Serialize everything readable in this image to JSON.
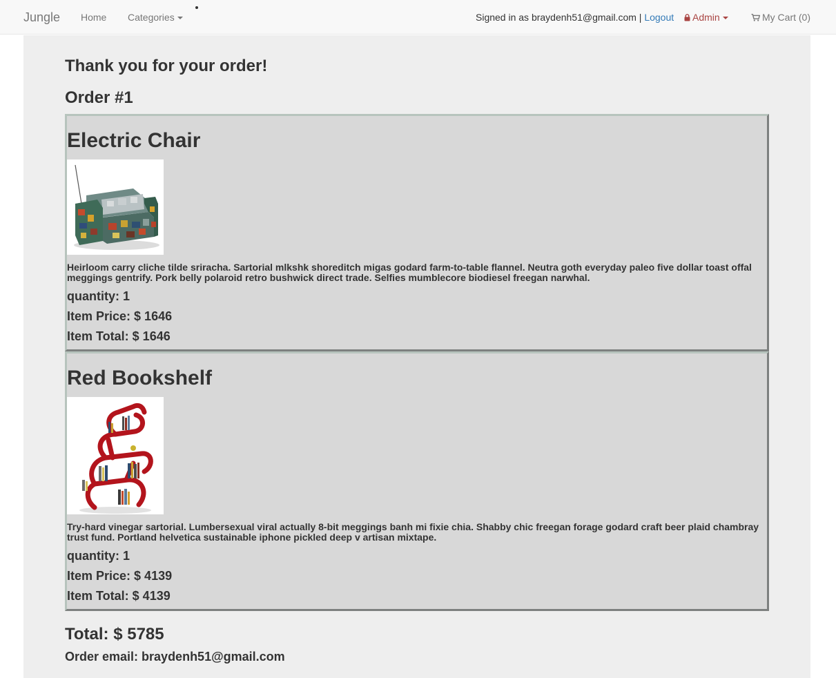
{
  "navbar": {
    "brand": "Jungle",
    "home": "Home",
    "categories": "Categories",
    "signed_in_text": "Signed in as braydenh51@gmail.com |",
    "logout": "Logout",
    "admin": "Admin",
    "cart": "My Cart (0)",
    "admin_color": "#a94442",
    "link_color": "#337ab7",
    "icons": [
      "lock-icon",
      "shopping-cart-icon",
      "caret-down-icon"
    ]
  },
  "page": {
    "heading": "Thank you for your order!",
    "order_number": "Order #1"
  },
  "items": [
    {
      "name": "Electric Chair",
      "image": "electric-chair-photo",
      "description": "Heirloom carry cliche tilde sriracha. Sartorial mlkshk shoreditch migas godard farm-to-table flannel. Neutra goth everyday paleo five dollar toast offal meggings gentrify. Pork belly polaroid retro bushwick direct trade. Selfies mumblecore biodiesel freegan narwhal.",
      "quantity": "quantity: 1",
      "price": "Item Price: $ 1646",
      "total": "Item Total: $ 1646"
    },
    {
      "name": "Red Bookshelf",
      "image": "red-bookshelf-photo",
      "description": "Try-hard vinegar sartorial. Lumbersexual viral actually 8-bit meggings banh mi fixie chia. Shabby chic freegan forage godard craft beer plaid chambray trust fund. Portland helvetica sustainable iphone pickled deep v artisan mixtape.",
      "quantity": "quantity: 1",
      "price": "Item Price: $ 4139",
      "total": "Item Total: $ 4139"
    }
  ],
  "summary": {
    "total": "Total: $ 5785",
    "email": "Order email: braydenh51@gmail.com"
  }
}
